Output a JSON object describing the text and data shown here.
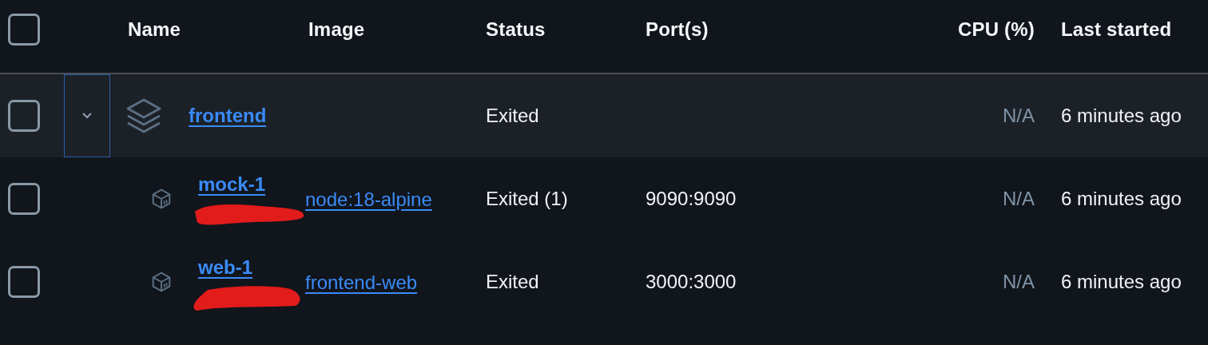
{
  "table": {
    "select_all": {
      "checked": false
    },
    "columns": [
      {
        "label": "Name"
      },
      {
        "label": "Image"
      },
      {
        "label": "Status"
      },
      {
        "label": "Port(s)"
      },
      {
        "label": "CPU (%)"
      },
      {
        "label": "Last started"
      }
    ],
    "rows": [
      {
        "kind": "group",
        "checked": false,
        "expanded": true,
        "name": "frontend",
        "status": "Exited",
        "cpu": "N/A",
        "last_started": "6 minutes ago",
        "children": [
          {
            "kind": "container",
            "checked": false,
            "name": "mock-1",
            "image": "node:18-alpine",
            "status": "Exited (1)",
            "ports": "9090:9090",
            "cpu": "N/A",
            "last_started": "6 minutes ago"
          },
          {
            "kind": "container",
            "checked": false,
            "name": "web-1",
            "image": "frontend-web",
            "status": "Exited",
            "ports": "3000:3000",
            "cpu": "N/A",
            "last_started": "6 minutes ago"
          }
        ]
      }
    ]
  }
}
